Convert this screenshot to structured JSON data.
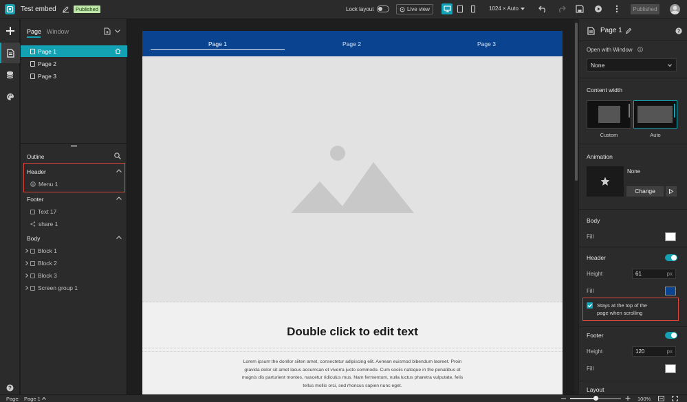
{
  "app": {
    "title": "Test embed",
    "status_badge": "Published",
    "lock_layout_label": "Lock layout",
    "live_view_label": "Live view",
    "screen_size": "1024 × Auto",
    "publish_label": "Published"
  },
  "left_panel": {
    "tabs": [
      "Page",
      "Window"
    ],
    "pages": [
      {
        "label": "Page 1",
        "active": true
      },
      {
        "label": "Page 2",
        "active": false
      },
      {
        "label": "Page 3",
        "active": false
      }
    ],
    "outline_title": "Outline",
    "outline": {
      "header": {
        "title": "Header",
        "items": [
          "Menu 1"
        ]
      },
      "footer": {
        "title": "Footer",
        "items": [
          "Text 17",
          "share 1"
        ]
      },
      "body": {
        "title": "Body",
        "items": [
          "Block 1",
          "Block 2",
          "Block 3",
          "Screen group 1"
        ]
      }
    }
  },
  "canvas": {
    "nav_tabs": [
      "Page 1",
      "Page 2",
      "Page 3"
    ],
    "active_tab": 0,
    "heading": "Double click to edit text",
    "lorem_lines": [
      "Lorem ipsum the donllor siiten amet, consectetur adipiscing elit. Aenean euismod bibendum laoreet. Proin",
      "gravida dolor sit amet lacus accumsan et viverra justo commodo. Cum sociis natoque in the penatibus et",
      "magnis dis parturient montes, nascetur ridiculus mus. Nam fermentum, nulla luctus pharetra vulputate, felis",
      "tellus mollis orci, sed rhoncus sapien nunc eget."
    ],
    "colors": {
      "nav": "#0a4490",
      "page_bg": "#f0f0f0",
      "placeholder": "#e2e2e2"
    }
  },
  "right_panel": {
    "page_title": "Page 1",
    "open_with_window_label": "Open with Window",
    "open_with_window_value": "None",
    "content_width_label": "Content width",
    "content_width_options": [
      "Custom",
      "Auto"
    ],
    "content_width_selected": "Auto",
    "animation_label": "Animation",
    "animation_value": "None",
    "animation_change": "Change",
    "body_label": "Body",
    "body_fill_label": "Fill",
    "body_fill_color": "#ffffff",
    "header_label": "Header",
    "header_enabled": true,
    "header_height_label": "Height",
    "header_height": "61",
    "header_height_unit": "px",
    "header_fill_label": "Fill",
    "header_fill_color": "#0a4490",
    "sticky_label_1": "Stays at the top of the",
    "sticky_label_2": "page when scrolling",
    "sticky_checked": true,
    "footer_label": "Footer",
    "footer_enabled": true,
    "footer_height_label": "Height",
    "footer_height": "120",
    "footer_height_unit": "px",
    "footer_fill_label": "Fill",
    "footer_fill_color": "#ffffff",
    "layout_label": "Layout",
    "accent": "#13a1b4"
  },
  "statusbar": {
    "page_label": "Page:",
    "page_value": "Page 1",
    "zoom": "100%",
    "zoom_level": 0.5
  }
}
